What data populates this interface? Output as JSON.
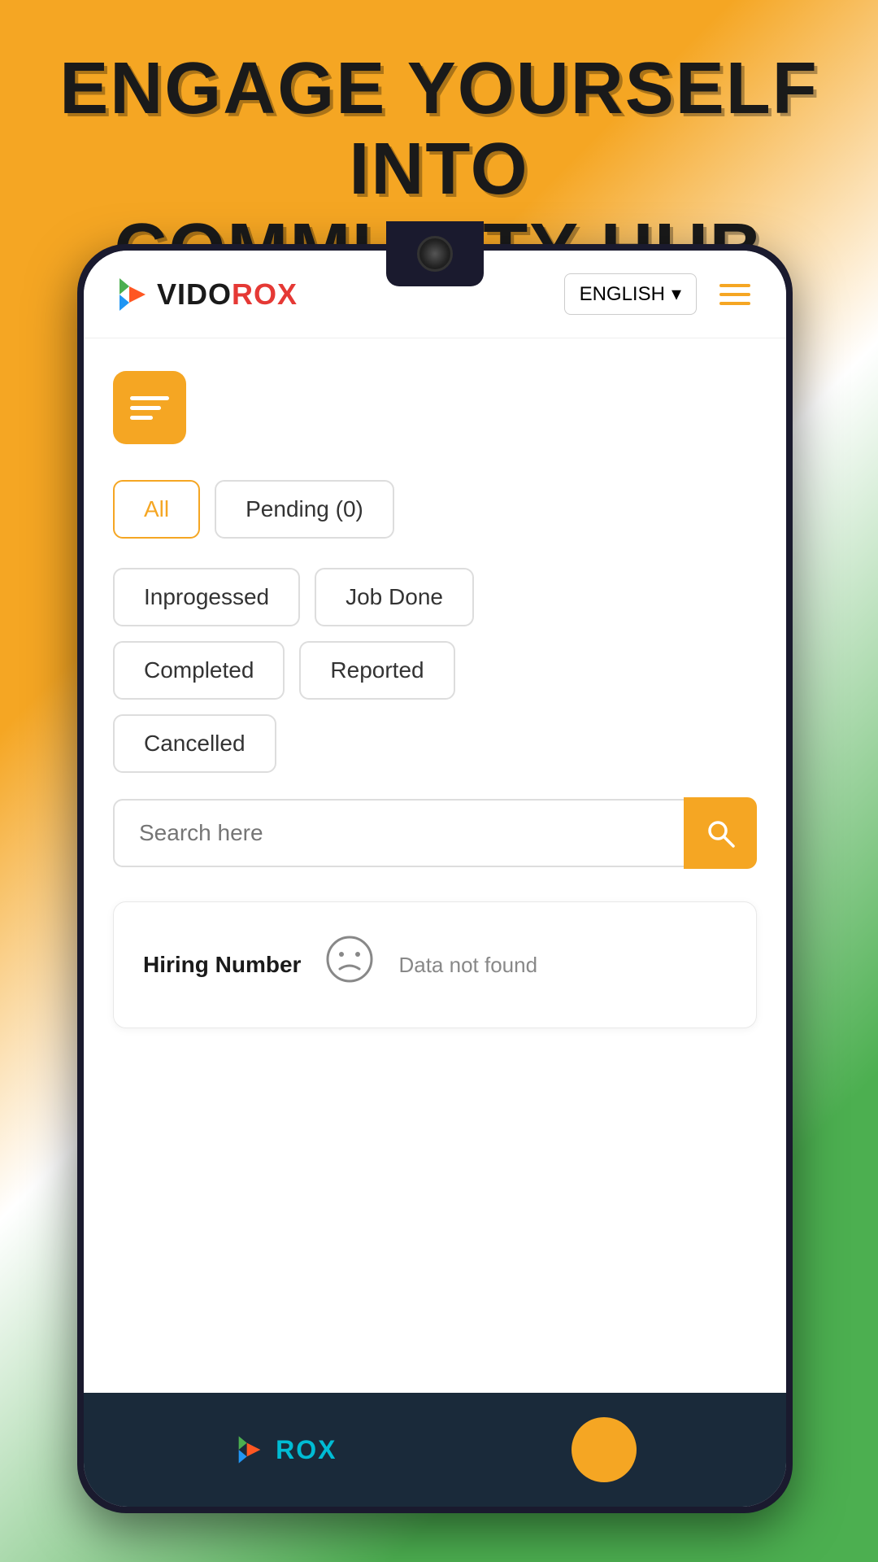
{
  "background": {
    "gradient": "orange-white-green"
  },
  "hero": {
    "line1": "ENGAGE YOURSELF INTO",
    "line2": "COMMUNITY HUB"
  },
  "header": {
    "logo_text_vido": "VIDO",
    "logo_text_rox": "ROX",
    "language_label": "ENGLISH",
    "language_dropdown_arrow": "▾"
  },
  "filters": {
    "all_label": "All",
    "pending_label": "Pending (0)",
    "inprogressed_label": "Inprogessed",
    "job_done_label": "Job Done",
    "completed_label": "Completed",
    "reported_label": "Reported",
    "cancelled_label": "Cancelled"
  },
  "search": {
    "placeholder": "Search here",
    "search_icon": "🔍"
  },
  "results": {
    "hiring_number_label": "Hiring Number",
    "empty_icon": "☹",
    "not_found_text": "Data not found"
  },
  "bottom_nav": {
    "brand_text": "ROX",
    "colors": {
      "accent": "#f5a623",
      "brand_text": "#00bcd4"
    }
  }
}
